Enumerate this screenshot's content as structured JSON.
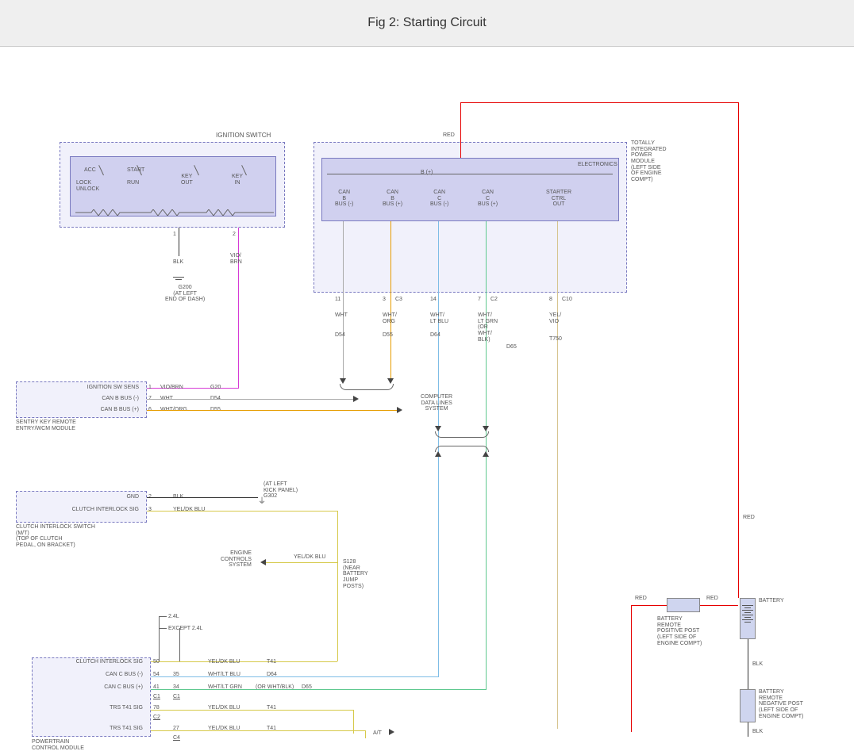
{
  "header": {
    "title": "Fig 2: Starting Circuit"
  },
  "blocks": {
    "ignition": {
      "title": "IGNITION SWITCH",
      "labels": [
        "ACC",
        "LOCK",
        "UNLOCK",
        "START",
        "RUN",
        "KEY OUT",
        "KEY IN"
      ]
    },
    "tipm": {
      "title": "TOTALLY\nINTEGRATED\nPOWER\nMODULE\n(LEFT SIDE\nOF ENGINE\nCOMPT)",
      "electronics": "ELECTRONICS",
      "b_plus": "B (+)",
      "pins": [
        "CAN\nB\nBUS (-)",
        "CAN\nB\nBUS (+)",
        "CAN\nC\nBUS (-)",
        "CAN\nC\nBUS (+)",
        "STARTER\nCTRL\nOUT"
      ]
    },
    "sentry": {
      "title": "SENTRY KEY REMOTE\nENTRY/WCM MODULE",
      "rows": [
        {
          "name": "IGNITION SW SENS",
          "pin": "1",
          "color": "VIO/BRN",
          "code": "G20"
        },
        {
          "name": "CAN B BUS (-)",
          "pin": "7",
          "color": "WHT",
          "code": "D54"
        },
        {
          "name": "CAN B BUS (+)",
          "pin": "6",
          "color": "WHT/ORG",
          "code": "D55"
        }
      ]
    },
    "clutch": {
      "title": "CLUTCH INTERLOCK SWITCH\n(M/T)\n(TOP OF CLUTCH\nPEDAL, ON BRACKET)",
      "rows": [
        {
          "name": "GND",
          "pin": "2",
          "color": "BLK"
        },
        {
          "name": "CLUTCH INTERLOCK SIG",
          "pin": "3",
          "color": "YEL/DK BLU"
        }
      ]
    },
    "pcm": {
      "title": "POWERTRAIN\nCONTROL MODULE",
      "variants": [
        "2.4L",
        "EXCEPT 2.4L"
      ],
      "rows": [
        {
          "name": "CLUTCH INTERLOCK SIG",
          "pin": "50",
          "color": "YEL/DK BLU",
          "code": "T41"
        },
        {
          "name": "CAN C BUS (-)",
          "pin": "54",
          "alt": "35",
          "color": "WHT/LT BLU",
          "code": "D64"
        },
        {
          "name": "CAN C BUS (+)",
          "pin": "41",
          "alt": "34",
          "color": "WHT/LT GRN",
          "code2": "(OR WHT/BLK)",
          "code": "D65"
        },
        {
          "name": "",
          "pin": "C1",
          "alt": "C1"
        },
        {
          "name": "TRS T41 SIG",
          "pin": "78",
          "color": "YEL/DK BLU",
          "code": "T41"
        },
        {
          "name": "",
          "pin": "C2"
        },
        {
          "name": "TRS T41 SIG",
          "pin": "27",
          "color": "YEL/DK BLU",
          "code": "T41"
        },
        {
          "name": "",
          "pin": "C4"
        }
      ]
    }
  },
  "wires": {
    "ign_out1": {
      "pin": "1",
      "color": "BLK"
    },
    "ign_out2": {
      "pin": "2",
      "color": "VIO/\nBRN"
    },
    "g200": "G200\n(AT LEFT\nEND OF DASH)",
    "red_label": "RED",
    "tipm_bottom": [
      {
        "pin": "11",
        "color": "WHT",
        "code": "D54"
      },
      {
        "pin": "3",
        "conn": "C3",
        "color": "WHT/\nORG",
        "code": "D55"
      },
      {
        "pin": "14",
        "color": "WHT/\nLT BLU",
        "code": "D64"
      },
      {
        "pin": "7",
        "conn": "C2",
        "color": "WHT/\nLT GRN\n(OR\nWHT/\nBLK)",
        "code": "D65"
      },
      {
        "pin": "8",
        "conn": "C10",
        "color": "YEL/\nVIO",
        "code": "T750"
      }
    ],
    "cdls": "COMPUTER\nDATA LINES\nSYSTEM",
    "ecs": "ENGINE\nCONTROLS\nSYSTEM",
    "s128": "S128\n(NEAR\nBATTERY\nJUMP\nPOSTS)",
    "g302": "(AT LEFT\nKICK PANEL)\nG302",
    "at": "A/T",
    "battery": {
      "title": "BATTERY",
      "pos": "BATTERY\nREMOTE\nPOSITIVE POST\n(LEFT SIDE OF\nENGINE COMPT)",
      "neg": "BATTERY\nREMOTE\nNEGATIVE POST\n(LEFT SIDE OF\nENGINE COMPT)",
      "red": "RED",
      "blk": "BLK"
    }
  }
}
